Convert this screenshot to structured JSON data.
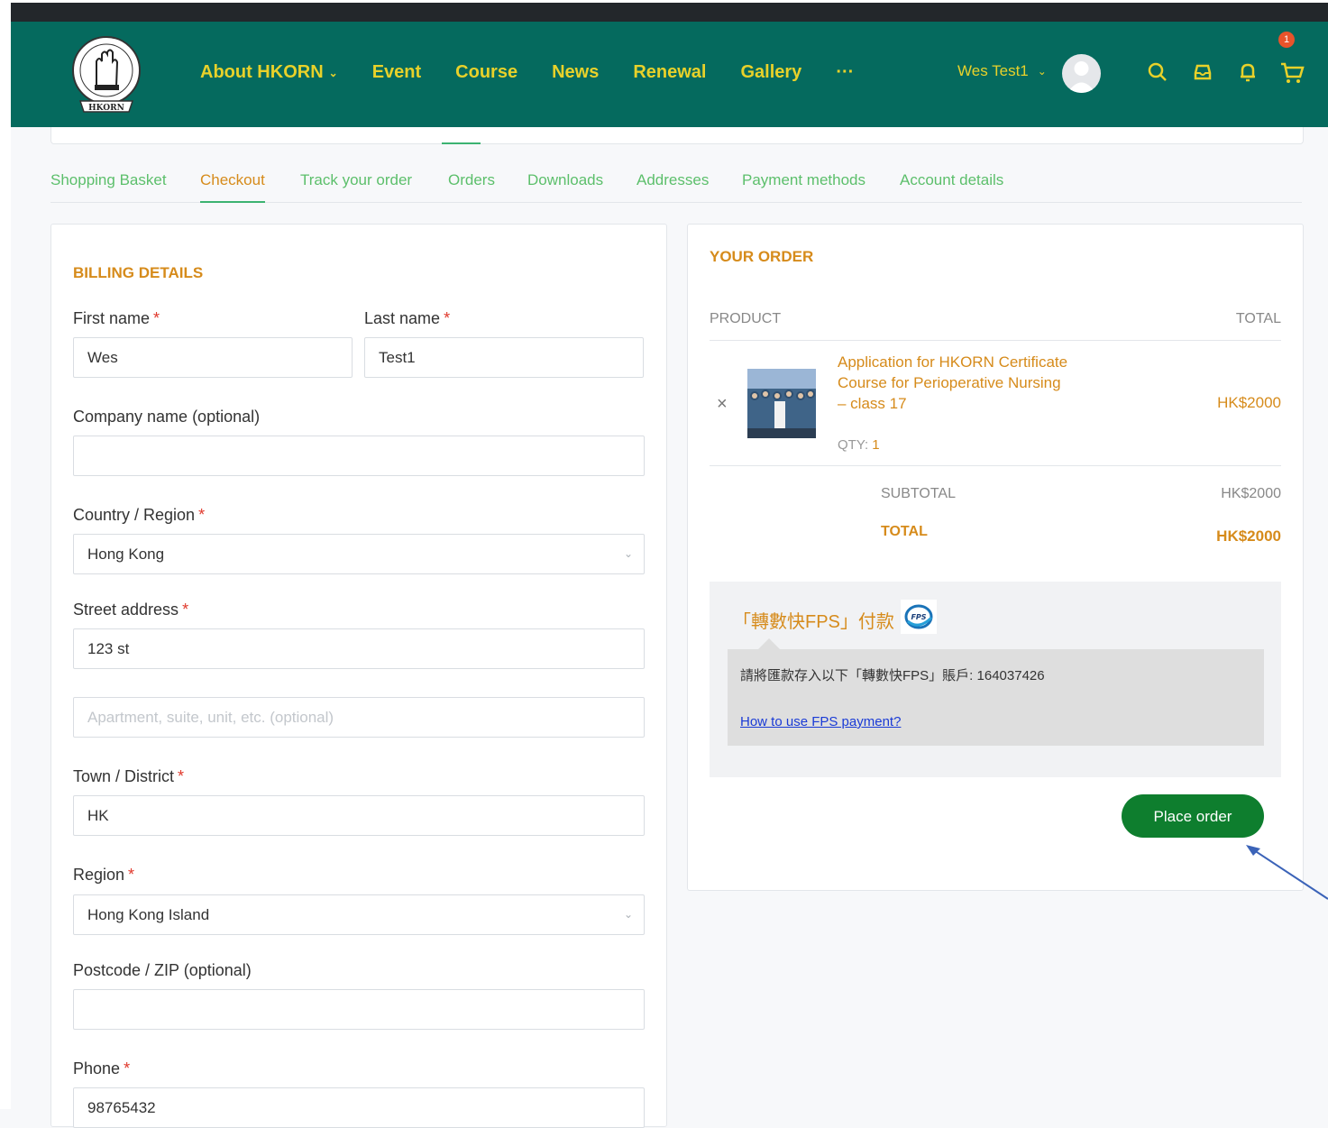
{
  "header": {
    "logo_text": "HKORN",
    "nav": [
      {
        "label": "About HKORN",
        "has_dropdown": true
      },
      {
        "label": "Event"
      },
      {
        "label": "Course"
      },
      {
        "label": "News"
      },
      {
        "label": "Renewal"
      },
      {
        "label": "Gallery"
      },
      {
        "label": "···"
      }
    ],
    "user_name": "Wes Test1",
    "cart_count": "1",
    "icons": [
      "search-icon",
      "inbox-icon",
      "bell-icon",
      "cart-icon"
    ],
    "brand_color": "#056a5e",
    "accent_color": "#e8d12a"
  },
  "tabs": [
    {
      "label": "Shopping Basket",
      "active": false
    },
    {
      "label": "Checkout",
      "active": true
    },
    {
      "label": "Track your order",
      "active": false
    },
    {
      "label": "Orders",
      "active": false
    },
    {
      "label": "Downloads",
      "active": false
    },
    {
      "label": "Addresses",
      "active": false
    },
    {
      "label": "Payment methods",
      "active": false
    },
    {
      "label": "Account details",
      "active": false
    }
  ],
  "billing": {
    "title": "BILLING DETAILS",
    "first_name": {
      "label": "First name",
      "value": "Wes"
    },
    "last_name": {
      "label": "Last name",
      "value": "Test1"
    },
    "company": {
      "label": "Company name (optional)",
      "value": ""
    },
    "country": {
      "label": "Country / Region",
      "value": "Hong Kong"
    },
    "street": {
      "label": "Street address",
      "value": "123 st",
      "placeholder2": "Apartment, suite, unit, etc. (optional)"
    },
    "town": {
      "label": "Town / District",
      "value": "HK"
    },
    "region": {
      "label": "Region",
      "value": "Hong Kong Island"
    },
    "postcode": {
      "label": "Postcode / ZIP (optional)",
      "value": ""
    },
    "phone": {
      "label": "Phone",
      "value": "98765432"
    },
    "required_mark": "*"
  },
  "order": {
    "title": "YOUR ORDER",
    "col_product": "PRODUCT",
    "col_total": "TOTAL",
    "product_name": "Application for HKORN Certificate Course for Perioperative Nursing – class 17",
    "qty_label": "QTY:",
    "qty_value": "1",
    "product_total": "HK$2000",
    "remove_symbol": "×",
    "subtotal_label": "SUBTOTAL",
    "subtotal_value": "HK$2000",
    "total_label": "TOTAL",
    "total_value": "HK$2000"
  },
  "payment": {
    "method_title": "「轉數快FPS」付款",
    "instruction": "請將匯款存入以下「轉數快FPS」賬戶: 164037426",
    "help_link": "How to use FPS payment?",
    "place_order": "Place order"
  }
}
